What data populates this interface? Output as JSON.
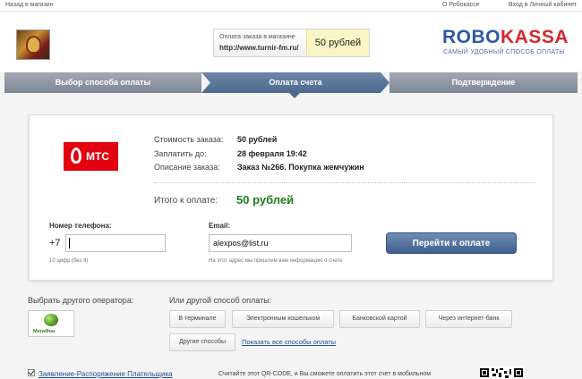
{
  "topbar": {
    "back": "Назад в магазин",
    "about": "О Робокассе",
    "cabinet": "Вход в Личный кабинет"
  },
  "header": {
    "order_caption": "Оплата заказа в магазине",
    "shop_url": "http://www.turnir-fm.ru/",
    "price": "50 рублей",
    "logo_part1": "ROBO",
    "logo_part2": "KASSA",
    "slogan": "САМЫЙ УДОБНЫЙ СПОСОБ ОПЛАТЫ"
  },
  "steps": [
    {
      "label": "Выбор способа оплаты",
      "active": false
    },
    {
      "label": "Оплата счета",
      "active": true
    },
    {
      "label": "Подтверждение",
      "active": false
    }
  ],
  "order": {
    "operator_logo": "МТС",
    "rows": [
      {
        "label": "Стоимость заказа:",
        "value": "50 рублей"
      },
      {
        "label": "Заплатить до:",
        "value": "28 февраля 19:42"
      },
      {
        "label": "Описание заказа:",
        "value": "Заказ №266. Покупка жемчужин"
      }
    ],
    "total_label": "Итого к оплате:",
    "total_value": "50 рублей"
  },
  "form": {
    "phone_label": "Номер телефона:",
    "phone_prefix": "+7",
    "phone_value": "",
    "phone_hint": "10 цифр (без 8)",
    "email_label": "Email:",
    "email_value": "alexpos@list.ru",
    "email_hint": "На этот адрес мы пришлем вам информацию о счете",
    "pay_button": "Перейти к оплате"
  },
  "other_operator": {
    "label": "Выбрать другого оператора:",
    "operators": [
      {
        "name": "МегаФон"
      }
    ]
  },
  "other_methods": {
    "label": "Или другой способ оплаты:",
    "methods": [
      "В терминале",
      "Электронным кошельком",
      "Банковской картой",
      "Через интернет-банк",
      "Другие способы"
    ],
    "show_all": "Показать все способы оплаты"
  },
  "footer": {
    "statement_checked": true,
    "statement_link": "Заявление-Распоряжение Плательщика",
    "qr_text": "Считайте этот QR-CODE, и Вы сможете оплатить этот счет в мобильном"
  },
  "colors": {
    "brand_blue": "#2b5aa5",
    "brand_red": "#d4272f",
    "total_green": "#1e7c1e",
    "mts_red": "#e3000f"
  }
}
